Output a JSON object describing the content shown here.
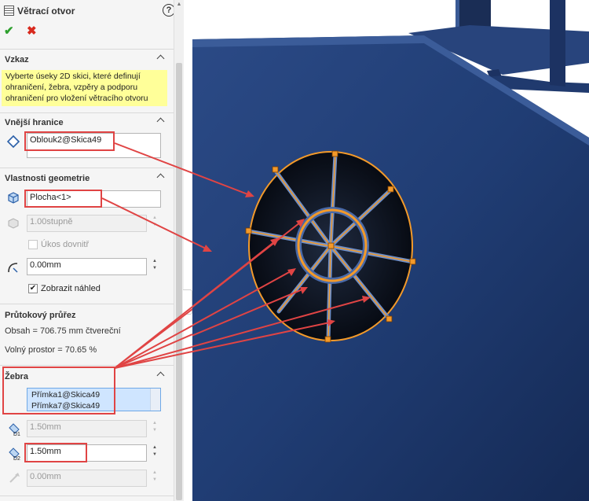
{
  "feature": {
    "title": "Větrací otvor"
  },
  "message": {
    "header": "Vzkaz",
    "text": "Vyberte úseky 2D skici, které definují ohraničení, žebra, vzpěry a podporu ohraničení pro vložení větracího otvoru"
  },
  "boundary": {
    "header": "Vnější hranice",
    "selection": "Oblouk2@Skica49"
  },
  "geometry": {
    "header": "Vlastnosti geometrie",
    "face": "Plocha<1>",
    "draft_angle": "1.00stupně",
    "draft_inward_label": "Úkos dovnitř",
    "fillet_radius": "0.00mm",
    "preview_label": "Zobrazit náhled",
    "preview_checked": true
  },
  "flow": {
    "header": "Průtokový průřez",
    "area": "Obsah = 706.75 mm čtvereční",
    "open": "Volný prostor = 70.65 %"
  },
  "ribs": {
    "header": "Žebra",
    "items": [
      "Přímka1@Skica49",
      "Přímka7@Skica49"
    ],
    "depth": "1.50mm",
    "width": "1.50mm",
    "offset": "0.00mm"
  },
  "colors": {
    "callout": "#e04444",
    "preview": "#f39a2a",
    "hint_bg": "#ffff99",
    "model": "#1f3868"
  },
  "icons": [
    "help-icon",
    "ok-check-icon",
    "cancel-x-icon",
    "boundary-diamond-icon",
    "face-cube-icon",
    "draft-angle-icon",
    "fillet-radius-icon",
    "rib-depth-icon",
    "rib-width-icon",
    "rib-offset-icon"
  ]
}
